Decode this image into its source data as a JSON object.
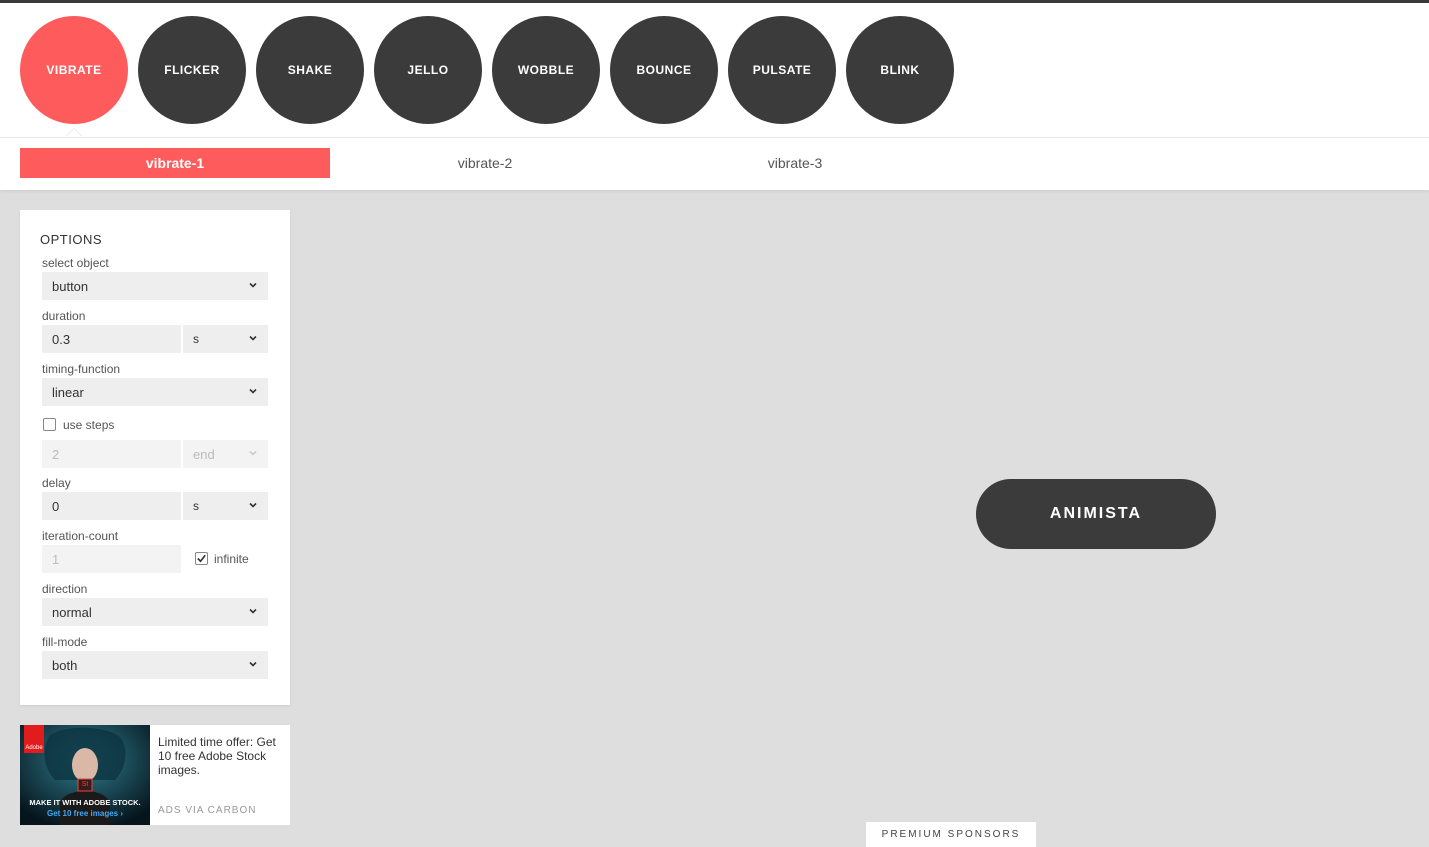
{
  "nav": {
    "effects": [
      "VIBRATE",
      "FLICKER",
      "SHAKE",
      "JELLO",
      "WOBBLE",
      "BOUNCE",
      "PULSATE",
      "BLINK"
    ],
    "active": "VIBRATE"
  },
  "variants": {
    "items": [
      "vibrate-1",
      "vibrate-2",
      "vibrate-3"
    ],
    "active": "vibrate-1"
  },
  "options": {
    "title": "OPTIONS",
    "select_object_label": "select object",
    "select_object_value": "button",
    "duration_label": "duration",
    "duration_value": "0.3",
    "duration_unit": "s",
    "timing_label": "timing-function",
    "timing_value": "linear",
    "use_steps_label": "use steps",
    "steps_value": "2",
    "steps_position": "end",
    "delay_label": "delay",
    "delay_value": "0",
    "delay_unit": "s",
    "iteration_label": "iteration-count",
    "iteration_value": "1",
    "infinite_label": "infinite",
    "direction_label": "direction",
    "direction_value": "normal",
    "fill_label": "fill-mode",
    "fill_value": "both"
  },
  "ad": {
    "text": "Limited time offer: Get 10 free Adobe Stock images.",
    "via": "ADS VIA CARBON",
    "image_caption": "MAKE IT WITH ADOBE STOCK.",
    "image_cta": "Get 10 free images ›",
    "logo_text": "Adobe",
    "badge_text": "St"
  },
  "demo": {
    "button_label": "ANIMISTA"
  },
  "footer": {
    "sponsors_label": "PREMIUM SPONSORS"
  },
  "colors": {
    "accent": "#fe5c5c",
    "dark": "#3b3b3b",
    "stage": "#dedede"
  }
}
